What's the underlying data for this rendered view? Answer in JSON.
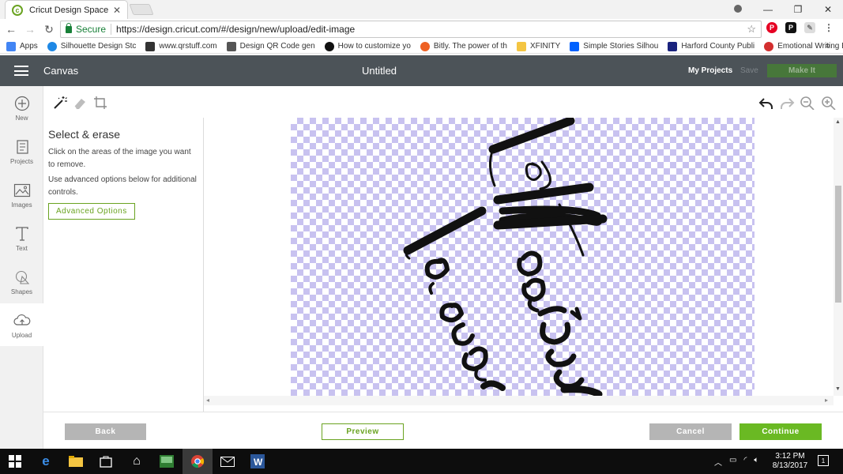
{
  "browser": {
    "tab_title": "Cricut Design Space",
    "tab_close": "✕",
    "secure_label": "Secure",
    "url": "https://design.cricut.com/#/design/new/upload/edit-image",
    "window_controls": [
      "—",
      "❐",
      "✕"
    ]
  },
  "bookmarks": {
    "items": [
      {
        "label": "Apps",
        "color": "#4285f4"
      },
      {
        "label": "Silhouette Design Stc",
        "color": "#1e88e5"
      },
      {
        "label": "www.qrstuff.com",
        "color": "#333333"
      },
      {
        "label": "Design QR Code gen",
        "color": "#555555"
      },
      {
        "label": "How to customize yo",
        "color": "#111111"
      },
      {
        "label": "Bitly. The power of th",
        "color": "#ee6123"
      },
      {
        "label": "XFINITY",
        "color": "#f4c542"
      },
      {
        "label": "Simple Stories Silhou",
        "color": "#0061fe"
      },
      {
        "label": "Harford County Publi",
        "color": "#1a237e"
      },
      {
        "label": "Emotional Writing BS",
        "color": "#d32f2f"
      }
    ],
    "more": "»"
  },
  "header": {
    "canvas_label": "Canvas",
    "document_title": "Untitled",
    "my_projects": "My Projects",
    "save": "Save",
    "make_it": "Make It"
  },
  "sidebar": {
    "items": [
      {
        "label": "New"
      },
      {
        "label": "Projects"
      },
      {
        "label": "Images"
      },
      {
        "label": "Text"
      },
      {
        "label": "Shapes"
      },
      {
        "label": "Upload"
      }
    ]
  },
  "panel": {
    "title": "Select & erase",
    "text1": "Click on the areas of the image you want to remove.",
    "text2": "Use advanced options below for additional controls.",
    "advanced_button": "Advanced Options"
  },
  "footer": {
    "back": "Back",
    "preview": "Preview",
    "cancel": "Cancel",
    "continue": "Continue"
  },
  "taskbar": {
    "time": "3:12 PM",
    "date": "8/13/2017"
  },
  "colors": {
    "accent_green": "#6ab923",
    "header_bg": "#4c5358",
    "checker_purple": "#c8c2f0"
  }
}
